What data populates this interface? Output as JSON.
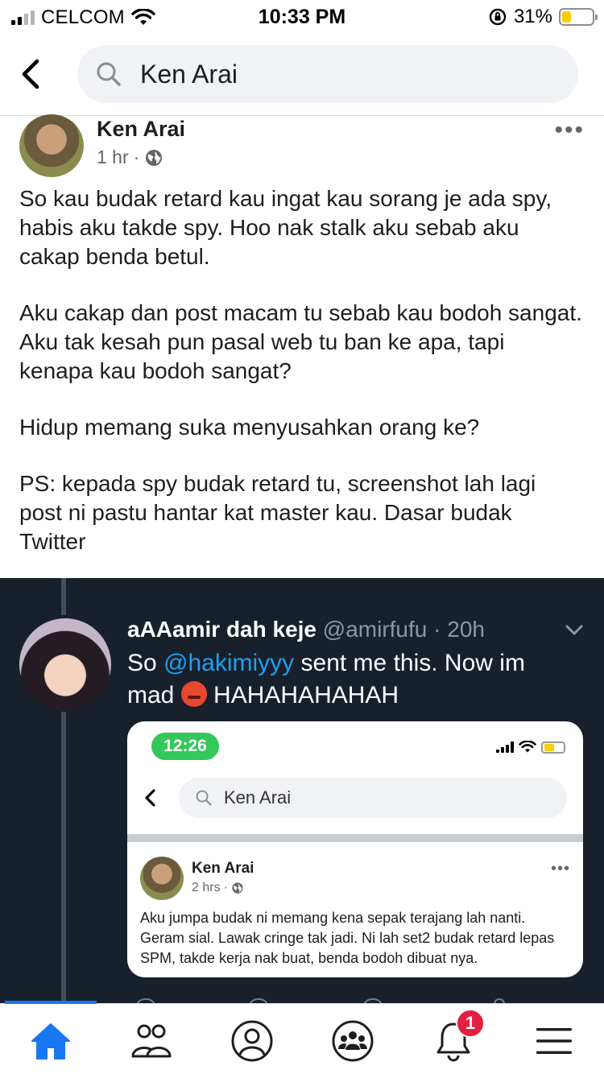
{
  "status_bar": {
    "carrier": "CELCOM",
    "time": "10:33 PM",
    "battery_percent": "31%",
    "battery_level": 0.31,
    "icons": [
      "signal-icon",
      "wifi-icon",
      "rotation-lock-icon",
      "battery-icon"
    ]
  },
  "search": {
    "query": "Ken Arai",
    "icons": [
      "back-chevron-icon",
      "search-icon"
    ]
  },
  "post": {
    "author": "Ken Arai",
    "time": "1 hr",
    "separator": "·",
    "paragraphs": [
      "So kau budak retard kau ingat kau sorang je ada spy, habis aku takde spy. Hoo nak stalk aku sebab aku cakap benda betul.",
      "Aku cakap dan post macam tu sebab kau bodoh sangat. Aku tak kesah pun pasal web tu ban ke apa, tapi kenapa kau bodoh sangat?",
      "Hidup memang suka menyusahkan orang ke?",
      "PS: kepada spy budak retard tu, screenshot lah lagi post ni pastu hantar kat master kau. Dasar budak Twitter"
    ]
  },
  "tweet": {
    "name": "aAAamir dah keje",
    "handle": "@amirfufu",
    "separator": "·",
    "time": "20h",
    "text_before": "So ",
    "mention": "@hakimiyyy",
    "text_after": " sent me this. Now im mad ",
    "text_end": " HAHAHAHAHAH",
    "embedded": {
      "status_time": "12:26",
      "search_query": "Ken Arai",
      "author": "Ken Arai",
      "time": "2 hrs",
      "separator": "·",
      "body": "Aku jumpa budak ni memang kena sepak terajang lah nanti. Geram sial. Lawak cringe tak jadi. Ni lah set2 budak retard lepas SPM, takde kerja nak buat, benda bodoh dibuat nya."
    }
  },
  "bottom_nav": {
    "items": [
      "home-icon",
      "friends-icon",
      "profile-icon",
      "groups-icon",
      "notifications-icon",
      "menu-icon"
    ],
    "notification_count": "1",
    "active": "home",
    "accent": "#1877f2",
    "badge_color": "#e41e3f"
  }
}
